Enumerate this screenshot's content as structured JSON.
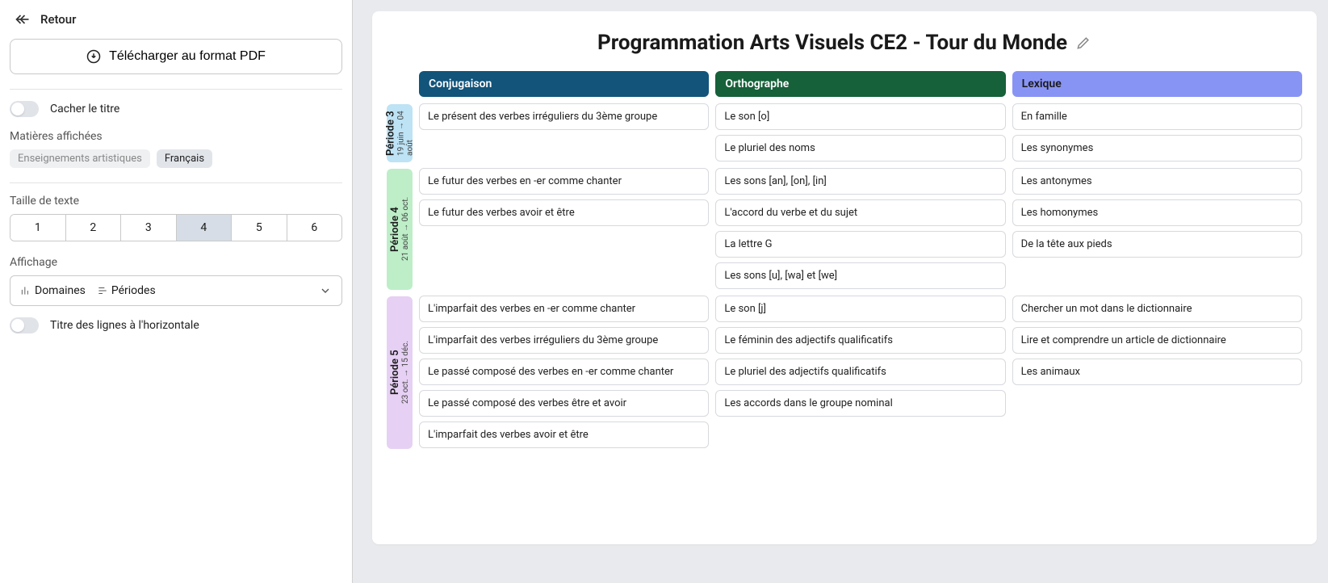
{
  "sidebar": {
    "back": "Retour",
    "download": "Télécharger au format PDF",
    "hide_title": "Cacher le titre",
    "subjects_label": "Matières affichées",
    "subjects": [
      {
        "label": "Enseignements artistiques",
        "active": false
      },
      {
        "label": "Français",
        "active": true
      }
    ],
    "text_size_label": "Taille de texte",
    "text_sizes": [
      "1",
      "2",
      "3",
      "4",
      "5",
      "6"
    ],
    "text_size_selected": "4",
    "display_label": "Affichage",
    "display_domains": "Domaines",
    "display_periods": "Périodes",
    "horizontal_rows": "Titre des lignes à l'horizontale"
  },
  "page": {
    "title": "Programmation Arts Visuels CE2 - Tour du Monde"
  },
  "columns": [
    {
      "label": "Conjugaison",
      "bg": "#12547a",
      "fg": "#ffffff"
    },
    {
      "label": "Orthographe",
      "bg": "#16603a",
      "fg": "#ffffff"
    },
    {
      "label": "Lexique",
      "bg": "#8894f4",
      "fg": "#1a1a1a"
    }
  ],
  "periods": [
    {
      "name": "Période 3",
      "range": "19 juin → 04 août",
      "bg": "#bde3f5",
      "rows": [
        [
          "Le présent des verbes irréguliers du 3ème groupe"
        ],
        [
          "Le son [o]",
          "Le pluriel des noms"
        ],
        [
          "En famille",
          "Les synonymes"
        ]
      ]
    },
    {
      "name": "Période 4",
      "range": "21 août → 06 oct.",
      "bg": "#bdeec8",
      "rows": [
        [
          "Le futur des verbes en -er comme chanter",
          "Le futur des verbes avoir et être"
        ],
        [
          "Les sons [an], [on], [in]",
          "L'accord du verbe et du sujet",
          "La lettre G",
          "Les sons [u], [wa] et [we]"
        ],
        [
          "Les antonymes",
          "Les homonymes",
          "De la tête aux pieds"
        ]
      ]
    },
    {
      "name": "Période 5",
      "range": "23 oct. → 15 déc.",
      "bg": "#e6d0f3",
      "rows": [
        [
          "L'imparfait des verbes en -er comme chanter",
          "L'imparfait des verbes irréguliers du 3ème groupe",
          "Le passé composé des verbes en -er comme chanter",
          "Le passé composé des verbes être et avoir",
          "L'imparfait des verbes avoir et être"
        ],
        [
          "Le son [j]",
          "Le féminin des adjectifs qualificatifs",
          "Le pluriel des adjectifs qualificatifs",
          "Les accords dans le groupe nominal"
        ],
        [
          "Chercher un mot dans le dictionnaire",
          "Lire et comprendre un article de dictionnaire",
          "Les animaux"
        ]
      ]
    }
  ]
}
